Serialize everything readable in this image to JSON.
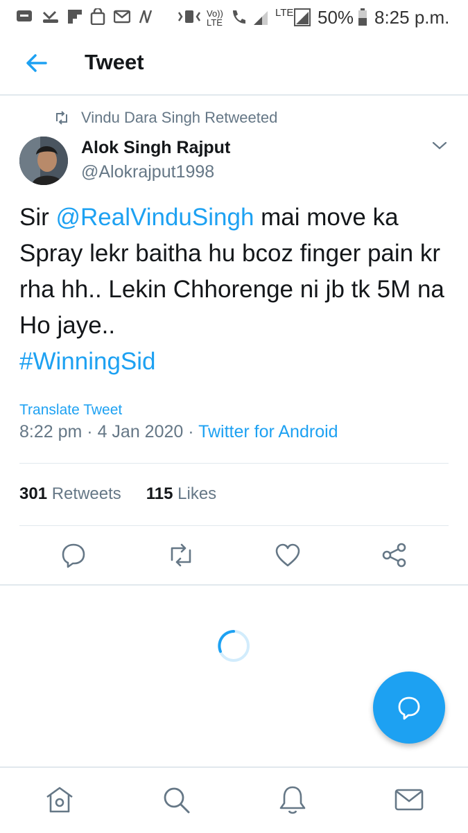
{
  "status_bar": {
    "battery": "50%",
    "time": "8:25 p.m.",
    "network": "LTE",
    "volte": "Vo)) LTE"
  },
  "header": {
    "title": "Tweet"
  },
  "tweet": {
    "retweeted_by": "Vindu Dara Singh Retweeted",
    "author_name": "Alok Singh Rajput",
    "author_handle": "@Alokrajput1998",
    "text_prefix": "Sir ",
    "mention": "@RealVinduSingh",
    "text_body": " mai move ka Spray lekr baitha hu bcoz finger pain kr rha hh.. Lekin Chhorenge ni jb tk 5M na Ho jaye..",
    "hashtag": "#WinningSid",
    "translate_label": "Translate Tweet",
    "time": "8:22 pm",
    "date": "4 Jan 2020",
    "separator": "·",
    "source": "Twitter for Android",
    "retweets_count": "301",
    "retweets_label": "Retweets",
    "likes_count": "115",
    "likes_label": "Likes"
  },
  "colors": {
    "accent": "#1da1f2",
    "secondary_text": "#657786",
    "primary_text": "#14171a",
    "divider": "#e1e8ed"
  },
  "icons": {
    "back": "arrow-left-icon",
    "caret": "chevron-down-icon",
    "reply": "reply-icon",
    "retweet": "retweet-icon",
    "like": "heart-icon",
    "share": "share-icon",
    "compose": "compose-reply-icon",
    "nav": [
      "home-icon",
      "search-icon",
      "notifications-icon",
      "messages-icon"
    ]
  }
}
